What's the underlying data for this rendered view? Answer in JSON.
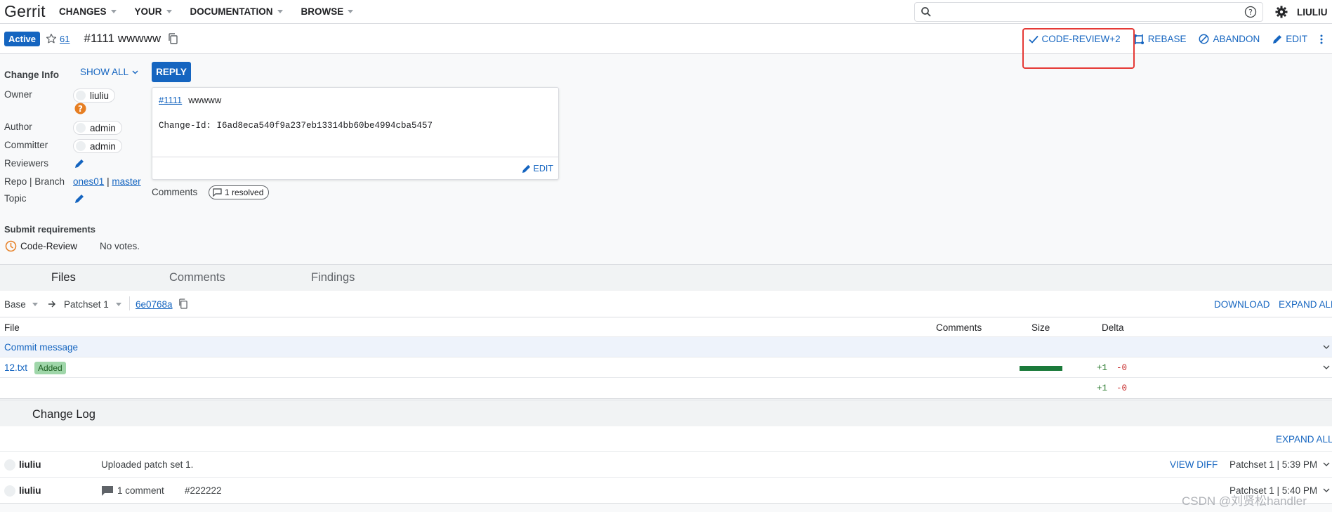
{
  "app": {
    "title": "Gerrit"
  },
  "topnav": {
    "items": [
      "CHANGES",
      "YOUR",
      "DOCUMENTATION",
      "BROWSE"
    ]
  },
  "search": {
    "value": "",
    "placeholder": ""
  },
  "account": {
    "name": "LIULIU"
  },
  "change": {
    "status": "Active",
    "star_count": "61",
    "title": "#1111 wwwww",
    "actions": {
      "code_review": "CODE-REVIEW+2",
      "rebase": "REBASE",
      "abandon": "ABANDON",
      "edit": "EDIT"
    }
  },
  "change_info": {
    "heading": "Change Info",
    "show_all": "SHOW ALL",
    "reply": "REPLY",
    "owner_label": "Owner",
    "owner": "liuliu",
    "author_label": "Author",
    "author": "admin",
    "committer_label": "Committer",
    "committer": "admin",
    "reviewers_label": "Reviewers",
    "repo_branch_label": "Repo | Branch",
    "repo": "ones01",
    "separator": "|",
    "branch": "master",
    "topic_label": "Topic"
  },
  "commit_message": {
    "number_link": "#1111",
    "subject": "wwwww",
    "change_id": "Change-Id: I6ad8eca540f9a237eb13314bb60be4994cba5457",
    "edit": "EDIT"
  },
  "comments": {
    "label": "Comments",
    "resolved": "1 resolved"
  },
  "submit_requirements": {
    "heading": "Submit requirements",
    "name": "Code-Review",
    "status": "No votes."
  },
  "tabs": [
    "Files",
    "Comments",
    "Findings"
  ],
  "files": {
    "base": "Base",
    "patchset": "Patchset 1",
    "commit_hash": "6e0768a",
    "download": "DOWNLOAD",
    "expand_all": "EXPAND ALL",
    "headers": {
      "file": "File",
      "comments": "Comments",
      "size": "Size",
      "delta": "Delta"
    },
    "commit_message_row": "Commit message",
    "rows": [
      {
        "name": "12.txt",
        "badge": "Added",
        "plus": "+1",
        "minus": "-0"
      }
    ],
    "total_plus": "+1",
    "total_minus": "-0"
  },
  "change_log": {
    "heading": "Change Log",
    "expand_all": "EXPAND ALL",
    "entries": [
      {
        "author": "liuliu",
        "message": "Uploaded patch set 1.",
        "view_diff": "VIEW DIFF",
        "meta": "Patchset 1 | 5:39 PM"
      },
      {
        "author": "liuliu",
        "comment_count": "1 comment",
        "message": "#222222",
        "meta": "Patchset 1 | 5:40 PM"
      }
    ]
  },
  "watermark": "CSDN @刘贤松handler",
  "colors": {
    "accent": "#1565c0",
    "highlight": "#e53935",
    "added": "#9fd6a9",
    "size_bar": "#1b7a3a"
  }
}
